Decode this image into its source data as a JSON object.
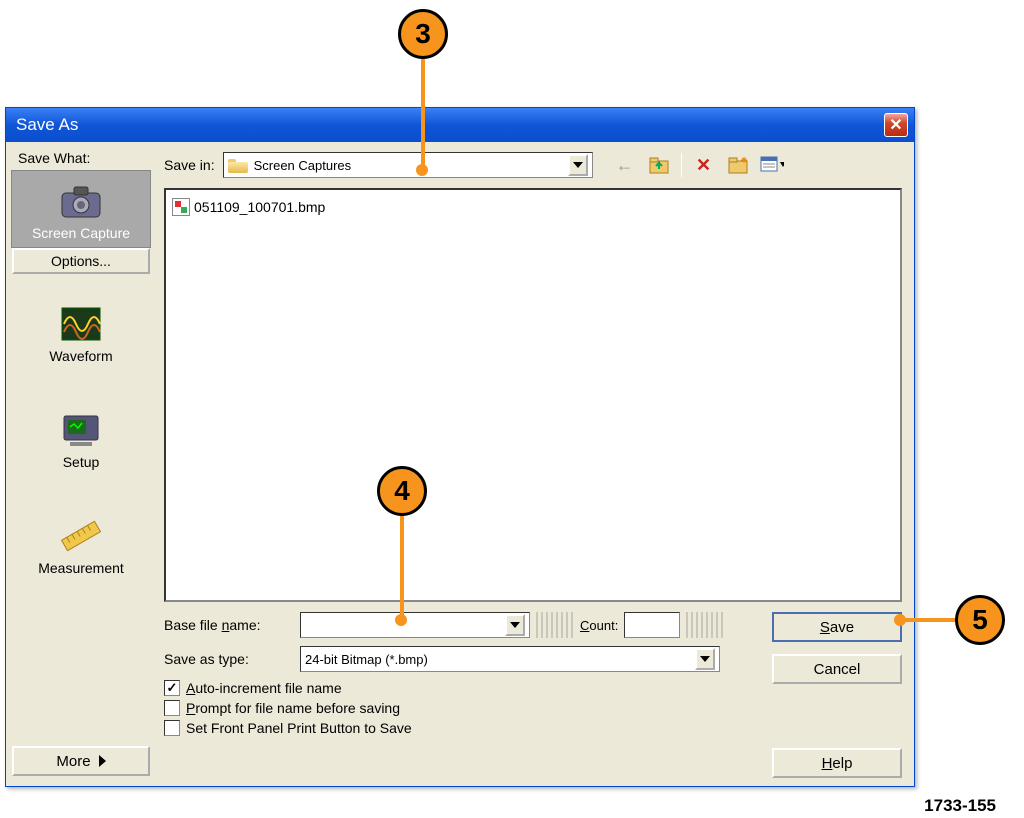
{
  "dialog": {
    "title": "Save As",
    "close": "✕"
  },
  "sidebar": {
    "title": "Save What:",
    "items": [
      {
        "label": "Screen Capture"
      },
      {
        "label": "Waveform"
      },
      {
        "label": "Setup"
      },
      {
        "label": "Measurement"
      }
    ],
    "options": "Options...",
    "more": "More"
  },
  "toolbar": {
    "save_in_label": "Save in:",
    "save_in_value": "Screen Captures"
  },
  "files": {
    "items": [
      {
        "name": "051109_100701.bmp"
      }
    ]
  },
  "form": {
    "base_label_pre": "Base file ",
    "base_label_u": "n",
    "base_label_post": "ame:",
    "base_value": "",
    "count_label_u": "C",
    "count_label_post": "ount:",
    "count_value": "",
    "type_label": "Save as type:",
    "type_value": "24-bit Bitmap (*.bmp)",
    "chk1_u": "A",
    "chk1_post": "uto-increment file name",
    "chk2_u": "P",
    "chk2_post": "rompt for file name before saving",
    "chk3": "Set Front Panel Print Button to Save",
    "chk1_checked": "✓"
  },
  "buttons": {
    "save_u": "S",
    "save_post": "ave",
    "cancel": "Cancel",
    "help_u": "H",
    "help_post": "elp"
  },
  "callouts": {
    "c3": "3",
    "c4": "4",
    "c5": "5"
  },
  "figure_ref": "1733-155"
}
